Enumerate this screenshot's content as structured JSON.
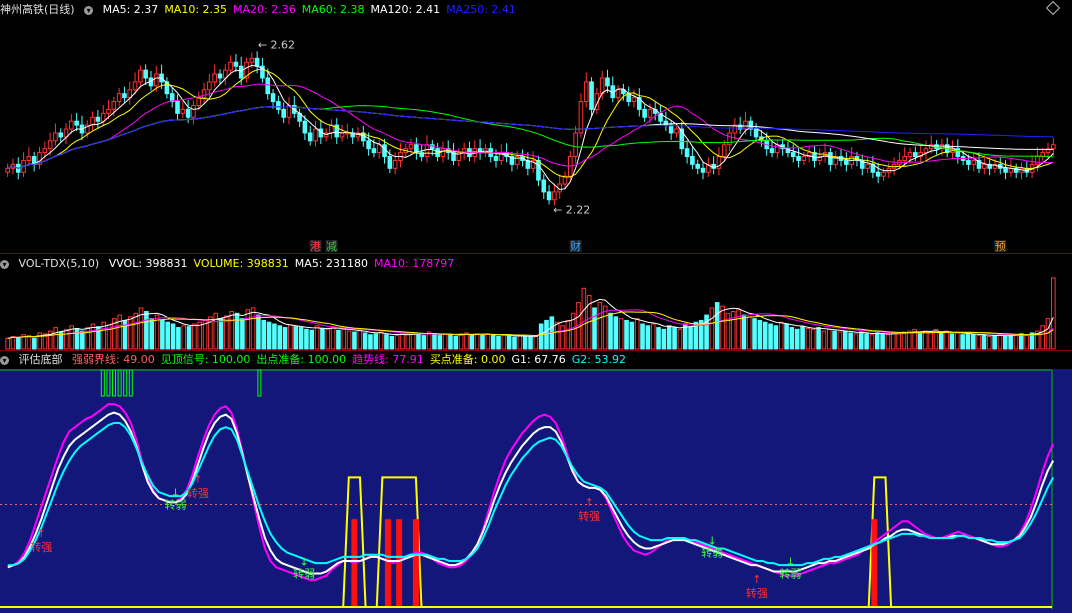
{
  "price_header": {
    "title": "神州高铁(日线)",
    "items": [
      {
        "text": "MA5: 2.37",
        "color": "#ffffff"
      },
      {
        "text": "MA10: 2.35",
        "color": "#ffff00"
      },
      {
        "text": "MA20: 2.36",
        "color": "#ff00ff"
      },
      {
        "text": "MA60: 2.38",
        "color": "#00ff00"
      },
      {
        "text": "MA120: 2.41",
        "color": "#ffffff"
      },
      {
        "text": "MA250: 2.41",
        "color": "#2020ff"
      }
    ]
  },
  "volume_header": {
    "title": "VOL-TDX(5,10)",
    "items": [
      {
        "text": "VVOL: 398831",
        "color": "#ffffff"
      },
      {
        "text": "VOLUME: 398831",
        "color": "#ffff00"
      },
      {
        "text": "MA5: 231180",
        "color": "#ffffff"
      },
      {
        "text": "MA10: 178797",
        "color": "#ff00ff"
      }
    ]
  },
  "indicator_header": {
    "title": "评估底部",
    "items": [
      {
        "text": "强弱界线: 49.00",
        "color": "#ff6060"
      },
      {
        "text": "见顶信号: 100.00",
        "color": "#00ff00"
      },
      {
        "text": "出点准备: 100.00",
        "color": "#00ff00"
      },
      {
        "text": "趋势线: 77.91",
        "color": "#ff00ff"
      },
      {
        "text": "买点准备: 0.00",
        "color": "#ffff00"
      },
      {
        "text": "G1: 67.76",
        "color": "#ffffff"
      },
      {
        "text": "G2: 53.92",
        "color": "#00ffff"
      }
    ]
  },
  "price_annotations": {
    "high": "2.62",
    "low": "2.22"
  },
  "event_badges": [
    {
      "text": "港",
      "color": "#ff4040",
      "day": 58
    },
    {
      "text": "减",
      "color": "#40c040",
      "day": 61
    },
    {
      "text": "财",
      "color": "#40a0ff",
      "day": 107
    },
    {
      "text": "预",
      "color": "#ff9020",
      "day": 187
    }
  ],
  "chart_data": [
    {
      "type": "candlestick",
      "title": "神州高铁(日线)",
      "ylim": [
        2.15,
        2.7
      ],
      "days": 200,
      "ma_values": {
        "MA5": 2.37,
        "MA10": 2.35,
        "MA20": 2.36,
        "MA60": 2.38,
        "MA120": 2.41,
        "MA250": 2.41
      },
      "close": [
        2.33,
        2.34,
        2.32,
        2.35,
        2.36,
        2.34,
        2.37,
        2.38,
        2.4,
        2.42,
        2.41,
        2.43,
        2.45,
        2.44,
        2.42,
        2.44,
        2.46,
        2.45,
        2.47,
        2.48,
        2.5,
        2.52,
        2.51,
        2.53,
        2.55,
        2.58,
        2.56,
        2.54,
        2.57,
        2.55,
        2.52,
        2.5,
        2.47,
        2.48,
        2.46,
        2.49,
        2.51,
        2.53,
        2.55,
        2.57,
        2.56,
        2.58,
        2.6,
        2.59,
        2.56,
        2.6,
        2.61,
        2.59,
        2.56,
        2.52,
        2.5,
        2.48,
        2.46,
        2.49,
        2.47,
        2.45,
        2.42,
        2.4,
        2.43,
        2.41,
        2.42,
        2.44,
        2.41,
        2.42,
        2.42,
        2.41,
        2.42,
        2.4,
        2.38,
        2.37,
        2.39,
        2.36,
        2.33,
        2.35,
        2.37,
        2.38,
        2.39,
        2.37,
        2.36,
        2.39,
        2.38,
        2.36,
        2.38,
        2.37,
        2.35,
        2.37,
        2.38,
        2.36,
        2.38,
        2.37,
        2.38,
        2.36,
        2.35,
        2.37,
        2.36,
        2.34,
        2.36,
        2.35,
        2.33,
        2.35,
        2.3,
        2.27,
        2.25,
        2.27,
        2.29,
        2.31,
        2.36,
        2.42,
        2.5,
        2.55,
        2.48,
        2.52,
        2.56,
        2.54,
        2.51,
        2.53,
        2.52,
        2.5,
        2.51,
        2.48,
        2.46,
        2.48,
        2.47,
        2.45,
        2.44,
        2.42,
        2.43,
        2.38,
        2.36,
        2.34,
        2.33,
        2.32,
        2.34,
        2.33,
        2.36,
        2.39,
        2.42,
        2.44,
        2.43,
        2.45,
        2.43,
        2.41,
        2.4,
        2.38,
        2.37,
        2.39,
        2.38,
        2.37,
        2.36,
        2.35,
        2.36,
        2.37,
        2.35,
        2.36,
        2.37,
        2.34,
        2.36,
        2.35,
        2.34,
        2.36,
        2.35,
        2.33,
        2.34,
        2.32,
        2.31,
        2.32,
        2.33,
        2.34,
        2.35,
        2.36,
        2.37,
        2.36,
        2.37,
        2.38,
        2.39,
        2.38,
        2.39,
        2.37,
        2.38,
        2.36,
        2.35,
        2.34,
        2.35,
        2.33,
        2.34,
        2.33,
        2.34,
        2.33,
        2.32,
        2.33,
        2.32,
        2.33,
        2.32,
        2.34,
        2.36,
        2.37,
        2.38,
        2.39
      ]
    },
    {
      "type": "bar",
      "title": "VOL-TDX(5,10)",
      "series_values": {
        "VVOL": 398831,
        "VOLUME": 398831,
        "MA5": 231180,
        "MA10": 178797
      },
      "ylim": [
        0,
        420000
      ],
      "values": [
        60,
        70,
        65,
        80,
        75,
        60,
        90,
        85,
        100,
        120,
        95,
        110,
        130,
        115,
        100,
        120,
        140,
        125,
        150,
        135,
        170,
        190,
        160,
        180,
        200,
        230,
        210,
        170,
        190,
        160,
        150,
        140,
        120,
        130,
        125,
        140,
        150,
        160,
        180,
        200,
        170,
        185,
        210,
        200,
        170,
        220,
        230,
        190,
        160,
        150,
        140,
        130,
        120,
        135,
        125,
        120,
        110,
        105,
        130,
        115,
        110,
        125,
        105,
        110,
        100,
        95,
        105,
        90,
        80,
        85,
        95,
        80,
        70,
        75,
        90,
        85,
        90,
        80,
        75,
        95,
        85,
        75,
        85,
        80,
        70,
        85,
        90,
        75,
        85,
        80,
        85,
        75,
        70,
        80,
        75,
        65,
        75,
        70,
        65,
        70,
        140,
        160,
        180,
        150,
        130,
        160,
        200,
        260,
        340,
        300,
        230,
        260,
        240,
        200,
        180,
        170,
        160,
        150,
        170,
        140,
        130,
        140,
        120,
        110,
        130,
        120,
        110,
        140,
        125,
        150,
        160,
        190,
        230,
        260,
        240,
        200,
        210,
        220,
        190,
        180,
        170,
        160,
        150,
        140,
        130,
        150,
        140,
        120,
        110,
        125,
        115,
        110,
        120,
        100,
        110,
        100,
        95,
        100,
        90,
        85,
        95,
        85,
        80,
        90,
        85,
        80,
        90,
        85,
        95,
        100,
        110,
        90,
        100,
        95,
        110,
        90,
        100,
        85,
        90,
        80,
        85,
        80,
        75,
        80,
        70,
        75,
        80,
        70,
        75,
        80,
        85,
        75,
        90,
        100,
        130,
        170,
        398
      ]
    },
    {
      "type": "line",
      "title": "评估底部",
      "ylim": [
        0,
        110
      ],
      "reference_line": 49,
      "series": [
        {
          "name": "趋势线",
          "color": "#ff00ff",
          "values": [
            19,
            20,
            22,
            26,
            32,
            40,
            48,
            56,
            64,
            72,
            79,
            84,
            86,
            88,
            90,
            91,
            93,
            95,
            97,
            97,
            96,
            93,
            88,
            80,
            70,
            62,
            56,
            52,
            51,
            50,
            50,
            52,
            56,
            63,
            72,
            80,
            87,
            92,
            95,
            96,
            93,
            85,
            74,
            62,
            50,
            38,
            28,
            22,
            19,
            18,
            17,
            16,
            15,
            14,
            13,
            13,
            14,
            15,
            18,
            20,
            22,
            22,
            21,
            22,
            23,
            25,
            24,
            23,
            22,
            21,
            22,
            24,
            25,
            26,
            26,
            25,
            23,
            21,
            20,
            19,
            19,
            20,
            22,
            25,
            30,
            37,
            46,
            55,
            63,
            70,
            75,
            79,
            83,
            86,
            89,
            91,
            92,
            91,
            88,
            82,
            74,
            66,
            60,
            58,
            57,
            57,
            56,
            52,
            46,
            40,
            34,
            30,
            27,
            26,
            25,
            26,
            28,
            30,
            32,
            33,
            33,
            33,
            32,
            31,
            30,
            29,
            28,
            27,
            26,
            25,
            24,
            23,
            22,
            21,
            20,
            19,
            18,
            17,
            16,
            15,
            15,
            15,
            16,
            17,
            18,
            19,
            20,
            21,
            21,
            22,
            23,
            24,
            25,
            27,
            29,
            31,
            33,
            35,
            37,
            39,
            41,
            41,
            39,
            37,
            35,
            34,
            33,
            33,
            34,
            35,
            36,
            35,
            34,
            33,
            32,
            31,
            30,
            29,
            29,
            30,
            32,
            35,
            40,
            47,
            55,
            64,
            72,
            78
          ]
        },
        {
          "name": "G1",
          "color": "#ffffff",
          "values": [
            19,
            20,
            21,
            24,
            29,
            35,
            42,
            50,
            58,
            66,
            72,
            77,
            80,
            82,
            84,
            86,
            88,
            90,
            92,
            93,
            92,
            89,
            84,
            77,
            68,
            60,
            55,
            52,
            51,
            50,
            50,
            51,
            54,
            60,
            68,
            76,
            83,
            88,
            91,
            92,
            90,
            83,
            73,
            62,
            52,
            42,
            33,
            27,
            23,
            21,
            20,
            19,
            18,
            17,
            16,
            16,
            16,
            17,
            19,
            21,
            22,
            22,
            22,
            22,
            23,
            24,
            24,
            23,
            22,
            22,
            22,
            23,
            24,
            25,
            25,
            24,
            23,
            22,
            21,
            20,
            20,
            21,
            23,
            26,
            30,
            36,
            43,
            51,
            58,
            64,
            69,
            73,
            77,
            80,
            83,
            85,
            86,
            86,
            84,
            79,
            72,
            65,
            60,
            58,
            57,
            57,
            56,
            53,
            48,
            43,
            38,
            34,
            31,
            29,
            28,
            28,
            29,
            30,
            31,
            32,
            32,
            32,
            31,
            30,
            29,
            28,
            27,
            26,
            25,
            24,
            23,
            22,
            21,
            20,
            20,
            19,
            18,
            17,
            17,
            17,
            17,
            17,
            18,
            19,
            20,
            21,
            21,
            22,
            22,
            23,
            24,
            25,
            26,
            27,
            28,
            30,
            31,
            33,
            34,
            36,
            37,
            37,
            36,
            35,
            34,
            33,
            33,
            33,
            33,
            34,
            34,
            34,
            33,
            33,
            32,
            31,
            30,
            30,
            30,
            31,
            32,
            34,
            38,
            43,
            50,
            58,
            65,
            70
          ]
        },
        {
          "name": "G2",
          "color": "#00ffff",
          "values": [
            20,
            20,
            21,
            23,
            27,
            32,
            38,
            45,
            52,
            59,
            65,
            70,
            74,
            77,
            79,
            81,
            83,
            85,
            87,
            88,
            88,
            86,
            82,
            76,
            69,
            63,
            58,
            55,
            54,
            53,
            53,
            53,
            55,
            59,
            65,
            71,
            77,
            82,
            85,
            86,
            85,
            80,
            72,
            64,
            56,
            48,
            41,
            35,
            31,
            28,
            26,
            25,
            24,
            23,
            22,
            21,
            21,
            21,
            22,
            23,
            24,
            24,
            24,
            24,
            25,
            25,
            25,
            25,
            24,
            24,
            24,
            24,
            25,
            25,
            25,
            25,
            24,
            23,
            23,
            22,
            22,
            22,
            23,
            25,
            28,
            33,
            39,
            46,
            52,
            58,
            63,
            67,
            71,
            74,
            77,
            79,
            80,
            81,
            80,
            77,
            72,
            67,
            63,
            60,
            59,
            58,
            57,
            55,
            51,
            47,
            43,
            39,
            36,
            34,
            33,
            32,
            32,
            32,
            33,
            33,
            33,
            33,
            32,
            32,
            31,
            30,
            29,
            28,
            28,
            27,
            26,
            25,
            24,
            23,
            22,
            22,
            21,
            21,
            20,
            20,
            20,
            20,
            20,
            21,
            21,
            22,
            23,
            23,
            24,
            24,
            25,
            26,
            27,
            28,
            29,
            30,
            31,
            32,
            33,
            34,
            35,
            35,
            35,
            34,
            34,
            33,
            33,
            33,
            33,
            33,
            34,
            34,
            33,
            33,
            33,
            32,
            32,
            31,
            31,
            31,
            32,
            33,
            36,
            40,
            45,
            51,
            57,
            62
          ]
        }
      ],
      "annotations": [
        {
          "text": "转强",
          "color": "#ff3030",
          "day": 6
        },
        {
          "text": "转弱",
          "color": "#40ff40",
          "day": 30
        },
        {
          "text": "转强",
          "color": "#ff3030",
          "day": 34
        },
        {
          "text": "转弱",
          "color": "#40ff40",
          "day": 53
        },
        {
          "text": "转强",
          "color": "#ff3030",
          "day": 104
        },
        {
          "text": "转弱",
          "color": "#40ff40",
          "day": 126
        },
        {
          "text": "转强",
          "color": "#ff3030",
          "day": 134
        },
        {
          "text": "转弱",
          "color": "#40ff40",
          "day": 140
        },
        {
          "text": "转强",
          "color": "#ff3030",
          "day": 193
        }
      ]
    }
  ]
}
